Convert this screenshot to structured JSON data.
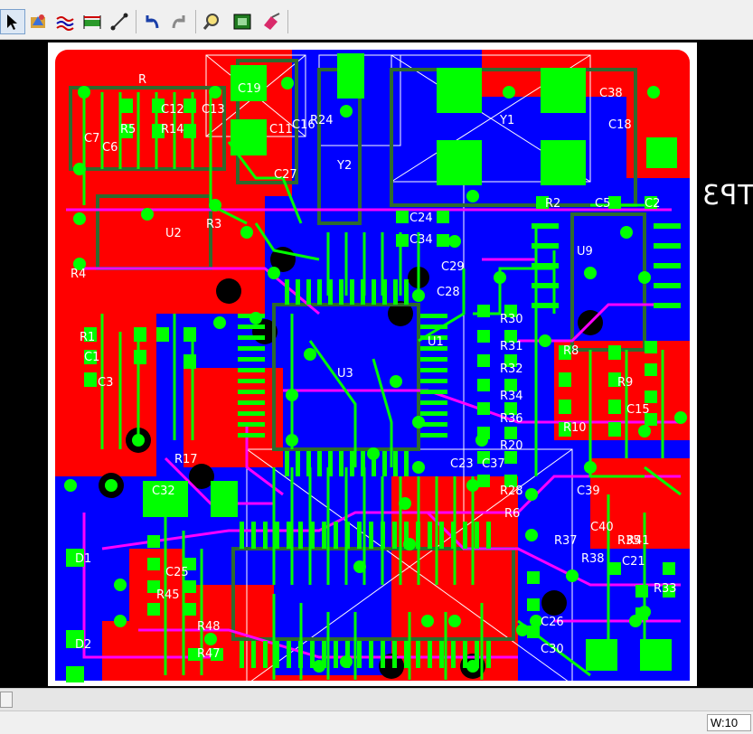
{
  "app": {
    "name": "PCB layout editor"
  },
  "toolbar": {
    "buttons": [
      {
        "id": "select",
        "icon": "arrow-pointer-icon",
        "active": true
      },
      {
        "id": "design-rules",
        "icon": "rules-wizard-icon"
      },
      {
        "id": "route",
        "icon": "autoroute-icon"
      },
      {
        "id": "measure",
        "icon": "dimension-icon"
      },
      {
        "id": "draw-line",
        "icon": "draw-line-icon"
      },
      {
        "id": "undo",
        "icon": "undo-icon"
      },
      {
        "id": "redo",
        "icon": "redo-icon"
      },
      {
        "id": "zoom",
        "icon": "zoom-icon"
      },
      {
        "id": "board-view",
        "icon": "board-view-icon"
      },
      {
        "id": "erase",
        "icon": "eraser-icon"
      }
    ]
  },
  "colors": {
    "top_copper": "#ff0000",
    "bottom_copper": "#0000ff",
    "pads": "#00ff00",
    "silkscreen": "#ffffff",
    "traces_top": "#00ff00",
    "traces_bottom": "#ff00ff",
    "background": "#000000"
  },
  "board": {
    "mirrored_text": "TP3",
    "components": [
      "R",
      "C7",
      "C6",
      "C12",
      "C13",
      "C19",
      "C11",
      "C16",
      "C18",
      "R5",
      "R14",
      "R24",
      "Y2",
      "Y1",
      "C38",
      "C27",
      "U2",
      "R3",
      "R4",
      "R1",
      "C1",
      "C3",
      "R2",
      "C5",
      "C2",
      "U9",
      "C24",
      "C34",
      "C29",
      "C28",
      "U3",
      "U1",
      "R8",
      "R9",
      "C15",
      "R10",
      "R17",
      "C32",
      "R6",
      "C39",
      "R37",
      "C21",
      "C26",
      "C30",
      "R47",
      "R45",
      "R48",
      "D1",
      "D2",
      "C25",
      "C40",
      "R38",
      "R41",
      "R35",
      "R33",
      "R30",
      "R31",
      "R32",
      "R34",
      "R36",
      "R20",
      "C37",
      "R28",
      "C23"
    ]
  },
  "status": {
    "width_label": "W:10"
  }
}
